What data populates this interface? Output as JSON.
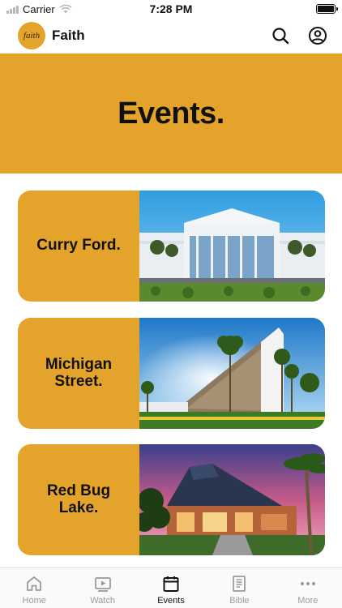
{
  "status_bar": {
    "carrier": "Carrier",
    "time": "7:28 PM"
  },
  "header": {
    "logo_text": "faith",
    "app_name": "Faith",
    "icons": [
      "search-icon",
      "profile-icon"
    ]
  },
  "hero": {
    "title": "Events."
  },
  "events": [
    {
      "label": "Curry Ford."
    },
    {
      "label": "Michigan Street."
    },
    {
      "label": "Red Bug Lake."
    }
  ],
  "tabs": [
    {
      "label": "Home",
      "icon": "home-icon",
      "active": false
    },
    {
      "label": "Watch",
      "icon": "play-icon",
      "active": false
    },
    {
      "label": "Events",
      "icon": "calendar-icon",
      "active": true
    },
    {
      "label": "Bible",
      "icon": "bible-icon",
      "active": false
    },
    {
      "label": "More",
      "icon": "more-icon",
      "active": false
    }
  ],
  "colors": {
    "accent": "#e4a32a",
    "text": "#111111",
    "inactive_tab": "#9a9a9a"
  }
}
